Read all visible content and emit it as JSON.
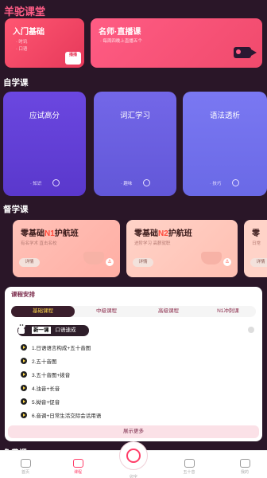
{
  "brand": "羊驼课堂",
  "top_cards": [
    {
      "title": "入门基础",
      "items": [
        "· 时讯",
        "· 口语"
      ],
      "badge": "播播"
    },
    {
      "title": "名师·直播课",
      "subtitle": "· 每周四晚上直播五个"
    }
  ],
  "self_study": {
    "title": "自学课",
    "cards": [
      {
        "title": "应试高分",
        "foot": "· 知识"
      },
      {
        "title": "词汇学习",
        "foot": "· 趣味"
      },
      {
        "title": "语法透析",
        "foot": "· 技巧"
      }
    ]
  },
  "camp": {
    "title": "督学课",
    "cards": [
      {
        "title_pre": "零基础",
        "title_hl": "N1",
        "title_post": "护航班",
        "sub": "有名学术 直击名校",
        "btn": "详情"
      },
      {
        "title_pre": "零基础",
        "title_hl": "N2",
        "title_post": "护航班",
        "sub": "进阶学习 高薪就职",
        "btn": "详情"
      },
      {
        "title_pre": "零",
        "title_hl": "",
        "title_post": "",
        "sub": "日常",
        "btn": "详情"
      }
    ]
  },
  "schedule": {
    "title": "课程安排",
    "tabs": [
      "基础课程",
      "中级课程",
      "高级课程",
      "N1冲刺课"
    ],
    "tag_label": "新一课",
    "tag_text": "口语速成",
    "lessons": [
      "1.日语语言构成+五十音图",
      "2.五十音图",
      "3.五十音图+拨音",
      "4.浊音+长音",
      "5.拗音+促音",
      "6.音调+日常生活交际会话用语"
    ],
    "more": "展示更多"
  },
  "free_title": "免费课",
  "tabbar": [
    "首页",
    "课程",
    "卯字",
    "五十音",
    "我的"
  ],
  "colors": {
    "accent": "#ff3d68",
    "bg": "#2a1628"
  }
}
